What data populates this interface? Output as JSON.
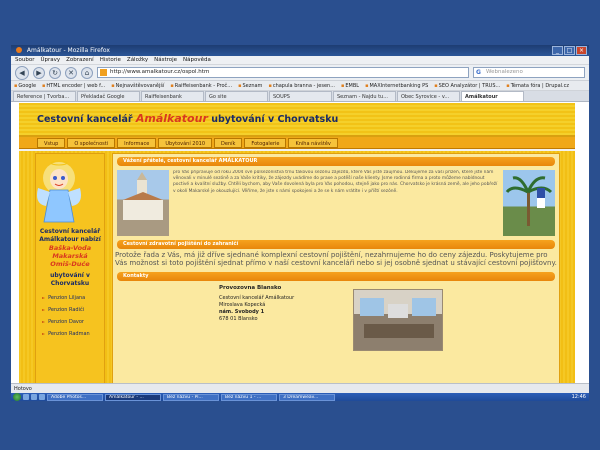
{
  "browser": {
    "window_title": "Amálkatour - Mozilla Firefox",
    "menu": [
      "Soubor",
      "Úpravy",
      "Zobrazení",
      "Historie",
      "Záložky",
      "Nástroje",
      "Nápověda"
    ],
    "url": "http://www.amalkatour.cz/ospol.htm",
    "search_placeholder": "Webnalezeno",
    "bookmarks": [
      "Google",
      "HTML encoder | web f...",
      "Nejnavštěvovanější",
      "Raiffeisenbank - Proč...",
      "Seznam",
      "chapula branna - jesen...",
      "EMBL",
      "MAXInternetbanking PS",
      "SEO Analyzátor | TRUS...",
      "Témata fóra | Drupal.cz"
    ],
    "tabs": [
      "Reference | Tvorba...",
      "Překladač Google",
      "Raiffeisenbank",
      "Go site",
      "SOUPS",
      "Seznam - Najdu tu...",
      "Obec Syrovice - v...",
      "Amálkatour"
    ],
    "status": "Hotovo",
    "active_tab_index": 7
  },
  "site": {
    "title_prefix": "Cestovní kancelář",
    "brand": "Amálkatour",
    "title_suffix": "ubytování v Chorvatsku",
    "nav": [
      "Vstup",
      "O společnosti",
      "Informace",
      "Ubytování 2010",
      "Deník",
      "Fotogalerie",
      "Kniha návštěv"
    ],
    "left": {
      "line1": "Cestovní kancelář",
      "line2": "Amálkatour nabízí",
      "place1": "Baška-Voda",
      "place2": "Makarská",
      "place3": "Omiš-Duće",
      "line3": "ubytování v",
      "line4": "Chorvatsku",
      "pensions": [
        "Penzion Liljana",
        "Penzion Radiči",
        "Penzion Davor",
        "Penzion Radman"
      ]
    },
    "sections": [
      {
        "heading": "Vážení přátelé, cestovní kancelář AMÁLKATOUR",
        "text": "pro Vás připravuje od roku 2004 své půlsezónístva trnu takovou sezónu zájezdů, které Vás jistě zaujmou. Děkujeme za vaši přízeň, které jste nám věnovali v minulé sezóně a za Vaše kritiky, že zájezdy uvádíme do praxe a potěší naše klienty. Jsme rodinná firma a proto můžeme nabídnout poctivé a kvalitní služby. Chtěli bychom, aby Vaše dovolená byla pro Vás pohodou, stejně jako pro nás. Chorvatsko je krásná země, ale jeho pobřeží v okolí Makarské je okouzlující. Věříme, že jste s námi spokojeni a že se k nám vrátíte i v příští sezóně."
      },
      {
        "heading": "Cestovní zdravotní pojištění do zahraničí",
        "text": "Protože řada z Vás, má již dříve sjednané komplexní cestovní pojištění, nezahrnujeme ho do ceny zájezdu. Poskytujeme pro Vás možnost si toto pojištění sjednat přímo v naší cestovní kanceláři nebo si jej osobně sjednat u stávající cestovní pojišťovny."
      },
      {
        "heading": "Kontakty",
        "office": "Provozovna Blansko",
        "company": "Cestovní kancelář Amálkatour",
        "person": "Miroslava Kopecká",
        "street": "nám. Svobody 1",
        "zip": "678 01 Blansko"
      }
    ]
  },
  "taskbar": {
    "items": [
      "Adobe Photos...",
      "Amálkatour - ...",
      "Bez názvu - Pi...",
      "Bez názvu 1 - ...",
      "3 Dreamweav..."
    ],
    "active_index": 1,
    "clock": "12:46"
  },
  "colors": {
    "accent": "#f2c317",
    "brand": "#d9381f",
    "heading": "#1a2a66",
    "section_bar": "#e8860b"
  }
}
